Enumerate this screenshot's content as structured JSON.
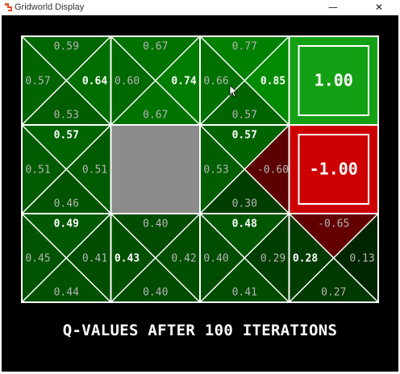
{
  "window": {
    "title": "Gridworld Display",
    "min_glyph": "—",
    "close_glyph": "✕",
    "icon": "python-icon"
  },
  "grid": {
    "rows": 3,
    "cols": 4,
    "cells": [
      {
        "type": "q",
        "values": {
          "north": "0.59",
          "east": "0.64",
          "south": "0.53",
          "west": "0.57"
        },
        "bold": "east"
      },
      {
        "type": "q",
        "values": {
          "north": "0.67",
          "east": "0.74",
          "south": "0.67",
          "west": "0.60"
        },
        "bold": "east"
      },
      {
        "type": "q",
        "values": {
          "north": "0.77",
          "east": "0.85",
          "south": "0.57",
          "west": "0.66"
        },
        "bold": "east"
      },
      {
        "type": "terminal",
        "value": "1.00",
        "color": "#14a014"
      },
      {
        "type": "q",
        "values": {
          "north": "0.57",
          "east": "0.51",
          "south": "0.46",
          "west": "0.51"
        },
        "bold": "north"
      },
      {
        "type": "wall",
        "color": "#8c8c8c"
      },
      {
        "type": "q",
        "values": {
          "north": "0.57",
          "east": "-0.60",
          "south": "0.30",
          "west": "0.53"
        },
        "bold": "north"
      },
      {
        "type": "terminal",
        "value": "-1.00",
        "color": "#cc0000"
      },
      {
        "type": "q",
        "values": {
          "north": "0.49",
          "east": "0.41",
          "south": "0.44",
          "west": "0.45"
        },
        "bold": "north"
      },
      {
        "type": "q",
        "values": {
          "north": "0.40",
          "east": "0.42",
          "south": "0.40",
          "west": "0.43"
        },
        "bold": "west"
      },
      {
        "type": "q",
        "values": {
          "north": "0.48",
          "east": "0.29",
          "south": "0.41",
          "west": "0.40"
        },
        "bold": "north"
      },
      {
        "type": "q",
        "values": {
          "north": "-0.65",
          "east": "0.13",
          "south": "0.27",
          "west": "0.28"
        },
        "bold": "west"
      }
    ]
  },
  "caption": "Q-VALUES AFTER 100 ITERATIONS",
  "colors": {
    "background": "#000000",
    "grid_line": "#ffffff",
    "positive": "#00a000",
    "negative": "#c80000",
    "value_text": "#b4b4b4",
    "bold_text": "#ffffff"
  }
}
